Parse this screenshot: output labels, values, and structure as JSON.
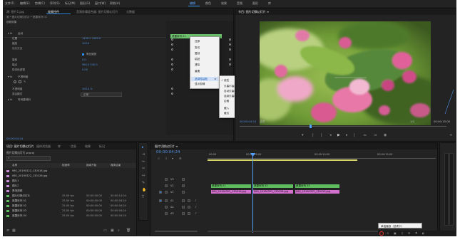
{
  "menu": {
    "items": [
      "文件(F)",
      "编辑(E)",
      "剪辑(C)",
      "序列(S)",
      "标记(M)",
      "图形(G)",
      "窗口(W)",
      "帮助(H)"
    ],
    "workspaces": [
      "编辑",
      "颜色",
      "效果",
      "音频",
      "图形",
      "库"
    ],
    "active_workspace": "编辑"
  },
  "effects_panel": {
    "tabs": [
      "源: 图片1.jpg",
      "效果控件",
      "音频剪辑混合器: 图片切换幻灯片",
      "元数据"
    ],
    "source_row": "源 * 图片切换幻灯片 * 遮罩序列 01",
    "clip_label": "遮罩序列 01",
    "section_video": "视频效果",
    "rows": [
      {
        "label": "运动",
        "value": ""
      },
      {
        "label": "位置",
        "value": "1440.0  1080.0"
      },
      {
        "label": "缩放",
        "value": "100.0"
      },
      {
        "label": "缩放宽度",
        "value": ""
      },
      {
        "label": "",
        "value": "等比缩放"
      },
      {
        "label": "旋转",
        "value": "0.0"
      },
      {
        "label": "锚点",
        "value": "960.0  540.0"
      },
      {
        "label": "防闪烁滤镜",
        "value": "0.00"
      },
      {
        "label": "不透明度",
        "value": ""
      },
      {
        "label": "蒙版",
        "value": ""
      },
      {
        "label": "不透明度",
        "value": "100.0 %"
      },
      {
        "label": "混合模式",
        "value": "正常"
      },
      {
        "label": "时间重映射",
        "value": ""
      }
    ],
    "timecode": "00:00:04:24",
    "mini_clip": "遮罩序列 01"
  },
  "context_menu_1": {
    "items": [
      "还原",
      "剪切",
      "复制",
      "粘贴",
      "清除",
      "重置",
      "选择性粘贴",
      "显示剪辑"
    ],
    "highlighted": "选择性粘贴"
  },
  "context_menu_2": {
    "items": [
      "线性",
      "贝塞尔曲线",
      "自动贝塞尔曲线",
      "连续贝塞尔曲线",
      "定格",
      "缓入",
      "缓出"
    ],
    "checked": "线性"
  },
  "program_monitor": {
    "title": "节目: 图片切换幻灯片 ≡",
    "timecode": "00:00:04:24",
    "fit": "适合",
    "quality": "1/2",
    "duration": "00:00:15:00"
  },
  "project_panel": {
    "tabs": [
      "项目: 图片切换幻灯片",
      "媒体浏览器",
      "库",
      "信息",
      "效果",
      "标记"
    ],
    "project_file": "图片切换幻灯片.prproj",
    "columns": [
      "名称",
      "帧速率",
      "媒体开始",
      "媒体结束"
    ],
    "items": [
      {
        "name": "IMG_20190322_130016.jpg",
        "fps": "",
        "start": "",
        "end": "",
        "color": "#c98ad8"
      },
      {
        "name": "IMG_20190322_130126.jpg",
        "fps": "",
        "start": "",
        "end": "",
        "color": "#c98ad8"
      },
      {
        "name": "图片1",
        "fps": "",
        "start": "",
        "end": "",
        "color": "#c98ad8"
      },
      {
        "name": "图片2",
        "fps": "",
        "start": "",
        "end": "",
        "color": "#c98ad8"
      },
      {
        "name": "黑场视频",
        "fps": "",
        "start": "",
        "end": "",
        "color": "#c98ad8"
      },
      {
        "name": "图片切换幻灯片",
        "fps": "25.00 fps",
        "start": "00:00:00:00",
        "end": "00:00:14:24",
        "color": "#5fbd5f"
      },
      {
        "name": "遮罩序列 01",
        "fps": "25.00 fps",
        "start": "00:00:00:00",
        "end": "00:00:04:24",
        "color": "#5fbd5f"
      },
      {
        "name": "遮罩序列 02",
        "fps": "25.00 fps",
        "start": "00:00:00:00",
        "end": "00:00:04:24",
        "color": "#5fbd5f"
      },
      {
        "name": "遮罩序列 03",
        "fps": "25.00 fps",
        "start": "00:00:00:00",
        "end": "00:00:04:24",
        "color": "#5fbd5f"
      },
      {
        "name": "遮罩序列 04",
        "fps": "25.00 fps",
        "start": "00:00:00:00",
        "end": "00:00:04:24",
        "color": "#5fbd5f"
      }
    ]
  },
  "timeline": {
    "title": "图片切换幻灯片 ≡",
    "timecode": "00:00:04:24",
    "ruler": [
      "00:00",
      "00:00:05:00",
      "00:00:10:00",
      "00:00:15:00"
    ],
    "tracks": [
      "V3",
      "V2",
      "V1",
      "A1",
      "A2",
      "A3"
    ],
    "v2_clips": [
      "遮罩序列 01",
      "遮罩序列 02",
      "遮罩序列 03"
    ],
    "v1_clips": [
      "IMG_20190322_130016.jpg",
      "IMG_20190322_130126.jpg",
      "IMG_20190322_130410.jpg"
    ]
  },
  "tooltip": "单独播放（选项卡）",
  "colors": {
    "accent": "#2d8ceb",
    "video_clip": "#d270d0",
    "audio_clip": "#5fbd5f",
    "playhead": "#4fa0ff"
  }
}
